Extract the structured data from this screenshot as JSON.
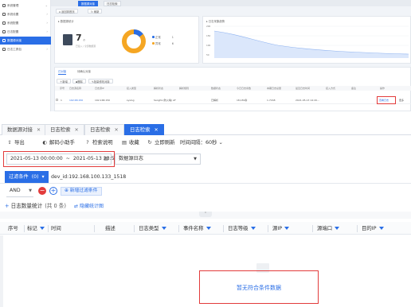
{
  "sidebar": {
    "items": [
      {
        "label": "系统管理",
        "active": false
      },
      {
        "label": "系统设置",
        "active": false
      },
      {
        "label": "系统配置",
        "active": false
      },
      {
        "label": "日志配置",
        "active": false
      },
      {
        "label": "数据源对接",
        "active": true
      },
      {
        "label": "日志工具包",
        "active": false
      }
    ]
  },
  "top_tabs": [
    {
      "label": "数据源对接",
      "active": true
    },
    {
      "label": "日志检索",
      "active": false
    }
  ],
  "top_toolbar": {
    "btn1": "返回到首页",
    "btn2": "刷新"
  },
  "source_stats": {
    "title": "▸ 数据源统计",
    "total": "7",
    "unit": "个",
    "sub": "已接入 / 全部数据源",
    "legend": [
      {
        "label": "正常",
        "value": "1",
        "color": "#2a6ee6"
      },
      {
        "label": "异常",
        "value": "6",
        "color": "#f5a623"
      }
    ],
    "donut": {
      "normal": 1,
      "abnormal": 6
    }
  },
  "ingest_chart": {
    "title": "▸ 日志采集趋势",
    "y_labels": [
      "200",
      "150",
      "100",
      "50"
    ]
  },
  "list_section": {
    "tabs": [
      "已对接",
      "待确认对接"
    ],
    "toolbar": [
      "新增",
      "删除",
      "批量修改对接"
    ],
    "columns": [
      "序号",
      "日志源名称",
      "日志源IP",
      "接入类型",
      "解析状态",
      "解析规则",
      "数据状态",
      "今日日志条数",
      "本期日志总量",
      "最近日志时间",
      "接入方式",
      "备注",
      "操作"
    ],
    "row": {
      "index": "1",
      "name": "192.68.150",
      "ip": "192.168.150",
      "type": "syslog",
      "rule": "Sangfor(防火墙) AF",
      "data_status": "已解析",
      "count": "18,189条",
      "total": "1.7168",
      "time": "2021-05-13 14:20...",
      "op_link": "查看日志",
      "op_more": "更多"
    }
  },
  "log_tabs": [
    {
      "label": "数据源对接",
      "active": false
    },
    {
      "label": "日志检索",
      "active": false
    },
    {
      "label": "日志检索",
      "active": false
    },
    {
      "label": "日志检索",
      "active": true
    }
  ],
  "toolbar": {
    "export": "导出",
    "helper": "解码小助手",
    "guide": "检索说明",
    "collect": "收藏",
    "refresh": "立即刷新",
    "interval": "时间间隔：60秒"
  },
  "time_range": {
    "start": "2021-05-13 00:00:00",
    "sep": "~",
    "end": "2021-05-13 23:59:59"
  },
  "source_select": {
    "value": "数据源日志"
  },
  "filter": {
    "chip_label": "过滤条件",
    "chip_count": "(0)",
    "expression": "dev_id:192.168.100.133_1518",
    "logic": "AND",
    "add_button": "新增过滤条件"
  },
  "stats": {
    "title": "日志数量统计",
    "count_text": "(共 0 条)",
    "collapse": "隐藏统计图"
  },
  "table": {
    "columns": [
      "序号",
      "标记",
      "时间",
      "",
      "描述",
      "日志类型",
      "事件名称",
      "日志等级",
      "源IP",
      "源端口",
      "目的IP"
    ],
    "empty_text": "暂无符合条件数据"
  }
}
